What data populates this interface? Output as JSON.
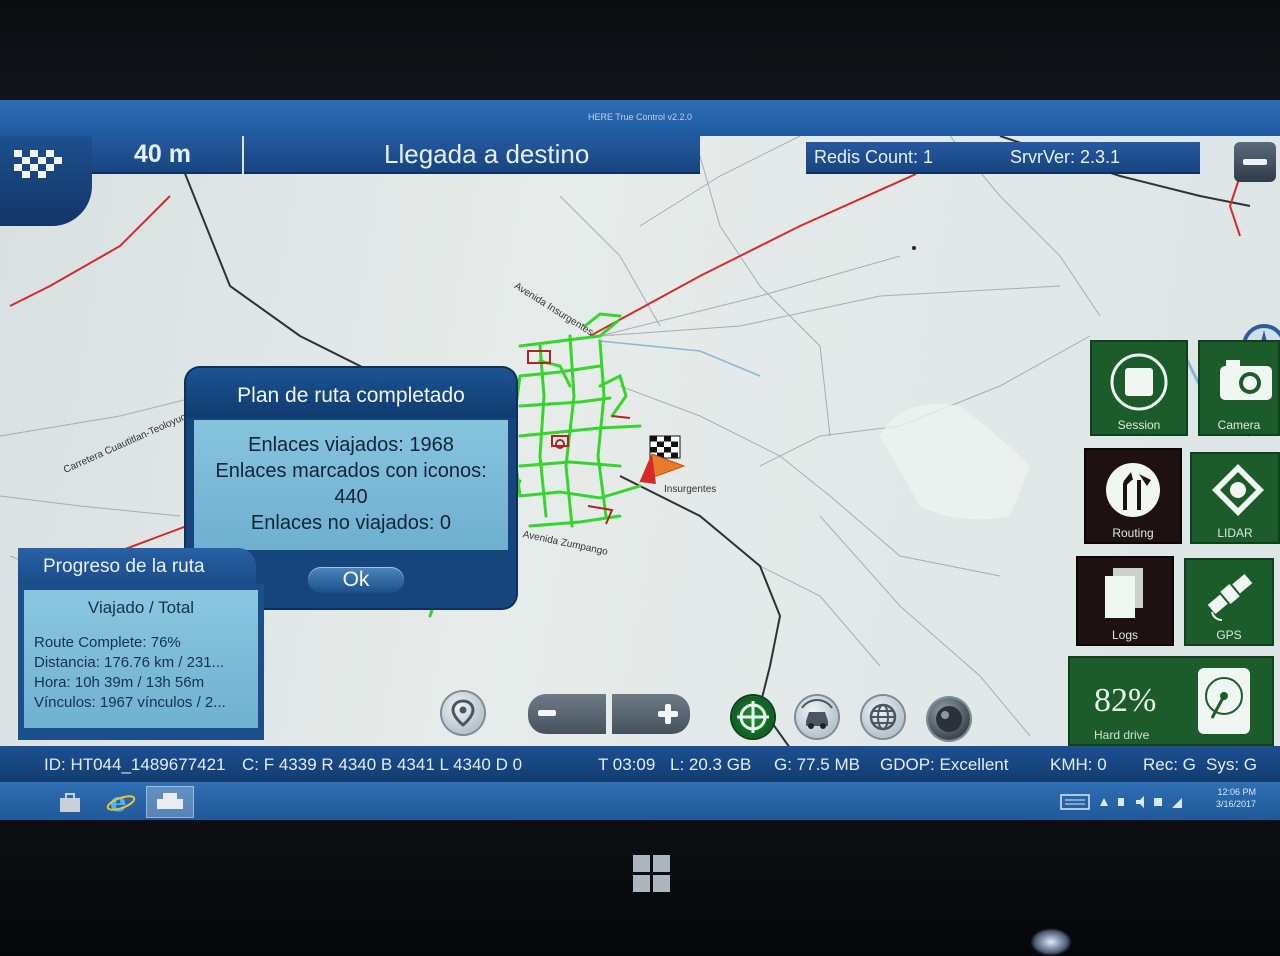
{
  "app": {
    "title": "HERE True Control v2.2.0"
  },
  "top_bar": {
    "distance": "40 m",
    "instruction": "Llegada a destino",
    "redis_count": "Redis Count: 1",
    "server_version": "SrvrVer: 2.3.1"
  },
  "dialog": {
    "title": "Plan de ruta completado",
    "lines": [
      "Enlaces viajados: 1968",
      "Enlaces marcados con iconos:",
      "440",
      "Enlaces no viajados: 0"
    ],
    "ok_label": "Ok"
  },
  "map": {
    "road_labels": [
      "Carretera Cuautitlan-Teoloyucan",
      "Avenida Insurgentes",
      "Insurgentes",
      "Avenida Zumpango"
    ]
  },
  "progress": {
    "tab_title": "Progreso de la ruta",
    "columns": "Viajado / Total",
    "lines": [
      "Route Complete: 76%",
      "Distancia: 176.76 km / 231...",
      "Hora: 10h 39m / 13h 56m",
      "Vínculos: 1967 vínculos / 2..."
    ]
  },
  "side_tiles": {
    "session": "Session",
    "camera": "Camera",
    "routing": "Routing",
    "lidar": "LIDAR",
    "logs": "Logs",
    "gps": "GPS",
    "hard_drive_value": "82%",
    "hard_drive_label": "Hard drive"
  },
  "status_bar": {
    "id": "ID: HT044_1489677421",
    "counters": "C: F 4339 R 4340 B 4341 L 4340 D 0",
    "time": "T 03:09",
    "lidar_space": "L:  20.3 GB",
    "gps_space": "G:  77.5 MB",
    "gdop": "GDOP: Excellent",
    "speed": "KMH: 0",
    "rec": "Rec: G",
    "sys": "Sys: G"
  },
  "taskbar": {
    "time": "12:06 PM",
    "date": "3/16/2017"
  },
  "colors": {
    "panel_blue": "#1a4f8b",
    "tile_green": "#1c5c2b",
    "route_green": "#34d62c",
    "red_line": "#d42a2a"
  }
}
